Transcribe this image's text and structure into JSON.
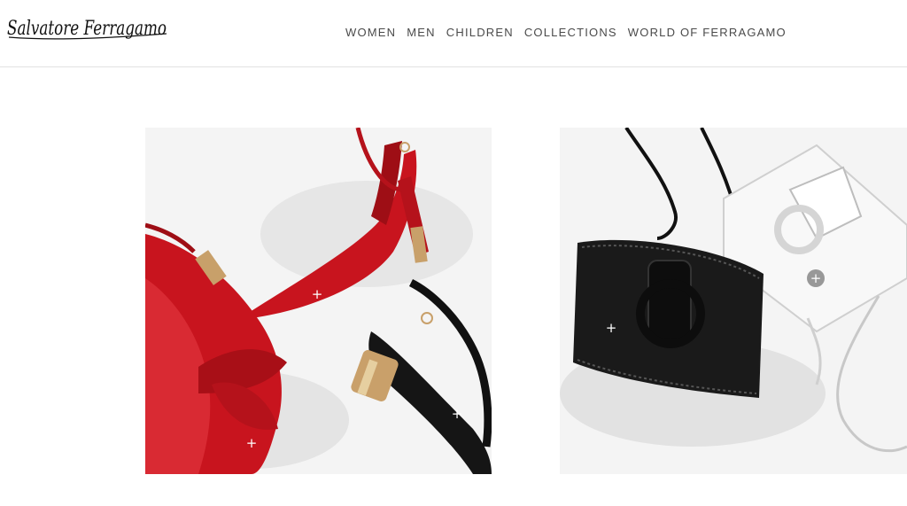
{
  "brand": {
    "logo_text": "Salvatore Ferragamo"
  },
  "nav": {
    "items": [
      {
        "label": "WOMEN"
      },
      {
        "label": "MEN"
      },
      {
        "label": "CHILDREN"
      },
      {
        "label": "COLLECTIONS"
      },
      {
        "label": "WORLD OF FERRAGAMO"
      }
    ]
  },
  "hotspots": {
    "symbol": "+"
  },
  "colors": {
    "accent_red": "#c8141e",
    "text_grey": "#4a4a4a",
    "divider": "#e2e2e2"
  }
}
